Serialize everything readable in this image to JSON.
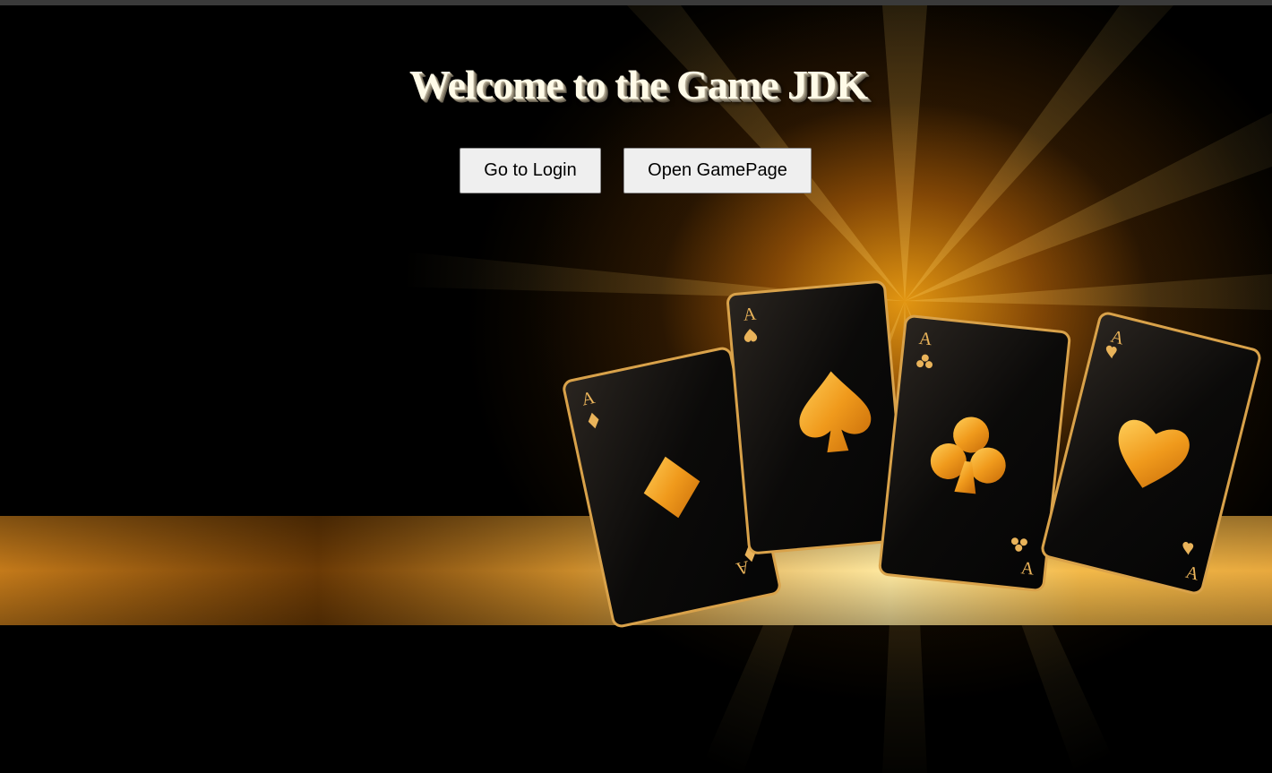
{
  "page": {
    "title": "Welcome to the Game JDK"
  },
  "buttons": {
    "login_label": "Go to Login",
    "gamepage_label": "Open GamePage"
  },
  "cards": [
    {
      "rank": "A",
      "suit": "diamond"
    },
    {
      "rank": "A",
      "suit": "spade"
    },
    {
      "rank": "A",
      "suit": "club"
    },
    {
      "rank": "A",
      "suit": "heart"
    }
  ],
  "colors": {
    "background": "#000000",
    "glow": "#ffb020",
    "gold": "#f0a020",
    "title_text": "#fffbe8",
    "button_bg": "#efefef"
  }
}
